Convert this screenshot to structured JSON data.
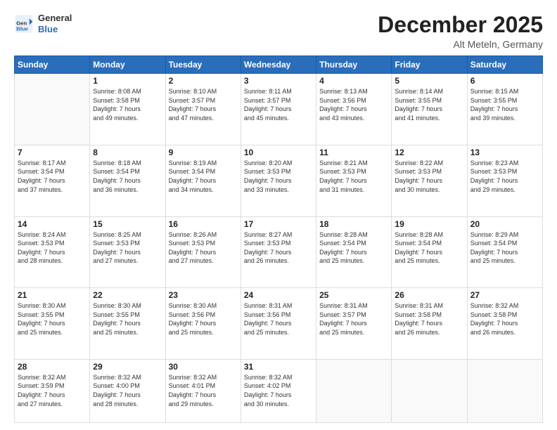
{
  "header": {
    "logo_general": "General",
    "logo_blue": "Blue",
    "month_title": "December 2025",
    "location": "Alt Meteln, Germany"
  },
  "days_of_week": [
    "Sunday",
    "Monday",
    "Tuesday",
    "Wednesday",
    "Thursday",
    "Friday",
    "Saturday"
  ],
  "weeks": [
    [
      {
        "num": "",
        "info": ""
      },
      {
        "num": "1",
        "info": "Sunrise: 8:08 AM\nSunset: 3:58 PM\nDaylight: 7 hours\nand 49 minutes."
      },
      {
        "num": "2",
        "info": "Sunrise: 8:10 AM\nSunset: 3:57 PM\nDaylight: 7 hours\nand 47 minutes."
      },
      {
        "num": "3",
        "info": "Sunrise: 8:11 AM\nSunset: 3:57 PM\nDaylight: 7 hours\nand 45 minutes."
      },
      {
        "num": "4",
        "info": "Sunrise: 8:13 AM\nSunset: 3:56 PM\nDaylight: 7 hours\nand 43 minutes."
      },
      {
        "num": "5",
        "info": "Sunrise: 8:14 AM\nSunset: 3:55 PM\nDaylight: 7 hours\nand 41 minutes."
      },
      {
        "num": "6",
        "info": "Sunrise: 8:15 AM\nSunset: 3:55 PM\nDaylight: 7 hours\nand 39 minutes."
      }
    ],
    [
      {
        "num": "7",
        "info": "Sunrise: 8:17 AM\nSunset: 3:54 PM\nDaylight: 7 hours\nand 37 minutes."
      },
      {
        "num": "8",
        "info": "Sunrise: 8:18 AM\nSunset: 3:54 PM\nDaylight: 7 hours\nand 36 minutes."
      },
      {
        "num": "9",
        "info": "Sunrise: 8:19 AM\nSunset: 3:54 PM\nDaylight: 7 hours\nand 34 minutes."
      },
      {
        "num": "10",
        "info": "Sunrise: 8:20 AM\nSunset: 3:53 PM\nDaylight: 7 hours\nand 33 minutes."
      },
      {
        "num": "11",
        "info": "Sunrise: 8:21 AM\nSunset: 3:53 PM\nDaylight: 7 hours\nand 31 minutes."
      },
      {
        "num": "12",
        "info": "Sunrise: 8:22 AM\nSunset: 3:53 PM\nDaylight: 7 hours\nand 30 minutes."
      },
      {
        "num": "13",
        "info": "Sunrise: 8:23 AM\nSunset: 3:53 PM\nDaylight: 7 hours\nand 29 minutes."
      }
    ],
    [
      {
        "num": "14",
        "info": "Sunrise: 8:24 AM\nSunset: 3:53 PM\nDaylight: 7 hours\nand 28 minutes."
      },
      {
        "num": "15",
        "info": "Sunrise: 8:25 AM\nSunset: 3:53 PM\nDaylight: 7 hours\nand 27 minutes."
      },
      {
        "num": "16",
        "info": "Sunrise: 8:26 AM\nSunset: 3:53 PM\nDaylight: 7 hours\nand 27 minutes."
      },
      {
        "num": "17",
        "info": "Sunrise: 8:27 AM\nSunset: 3:53 PM\nDaylight: 7 hours\nand 26 minutes."
      },
      {
        "num": "18",
        "info": "Sunrise: 8:28 AM\nSunset: 3:54 PM\nDaylight: 7 hours\nand 25 minutes."
      },
      {
        "num": "19",
        "info": "Sunrise: 8:28 AM\nSunset: 3:54 PM\nDaylight: 7 hours\nand 25 minutes."
      },
      {
        "num": "20",
        "info": "Sunrise: 8:29 AM\nSunset: 3:54 PM\nDaylight: 7 hours\nand 25 minutes."
      }
    ],
    [
      {
        "num": "21",
        "info": "Sunrise: 8:30 AM\nSunset: 3:55 PM\nDaylight: 7 hours\nand 25 minutes."
      },
      {
        "num": "22",
        "info": "Sunrise: 8:30 AM\nSunset: 3:55 PM\nDaylight: 7 hours\nand 25 minutes."
      },
      {
        "num": "23",
        "info": "Sunrise: 8:30 AM\nSunset: 3:56 PM\nDaylight: 7 hours\nand 25 minutes."
      },
      {
        "num": "24",
        "info": "Sunrise: 8:31 AM\nSunset: 3:56 PM\nDaylight: 7 hours\nand 25 minutes."
      },
      {
        "num": "25",
        "info": "Sunrise: 8:31 AM\nSunset: 3:57 PM\nDaylight: 7 hours\nand 25 minutes."
      },
      {
        "num": "26",
        "info": "Sunrise: 8:31 AM\nSunset: 3:58 PM\nDaylight: 7 hours\nand 26 minutes."
      },
      {
        "num": "27",
        "info": "Sunrise: 8:32 AM\nSunset: 3:58 PM\nDaylight: 7 hours\nand 26 minutes."
      }
    ],
    [
      {
        "num": "28",
        "info": "Sunrise: 8:32 AM\nSunset: 3:59 PM\nDaylight: 7 hours\nand 27 minutes."
      },
      {
        "num": "29",
        "info": "Sunrise: 8:32 AM\nSunset: 4:00 PM\nDaylight: 7 hours\nand 28 minutes."
      },
      {
        "num": "30",
        "info": "Sunrise: 8:32 AM\nSunset: 4:01 PM\nDaylight: 7 hours\nand 29 minutes."
      },
      {
        "num": "31",
        "info": "Sunrise: 8:32 AM\nSunset: 4:02 PM\nDaylight: 7 hours\nand 30 minutes."
      },
      {
        "num": "",
        "info": ""
      },
      {
        "num": "",
        "info": ""
      },
      {
        "num": "",
        "info": ""
      }
    ]
  ]
}
